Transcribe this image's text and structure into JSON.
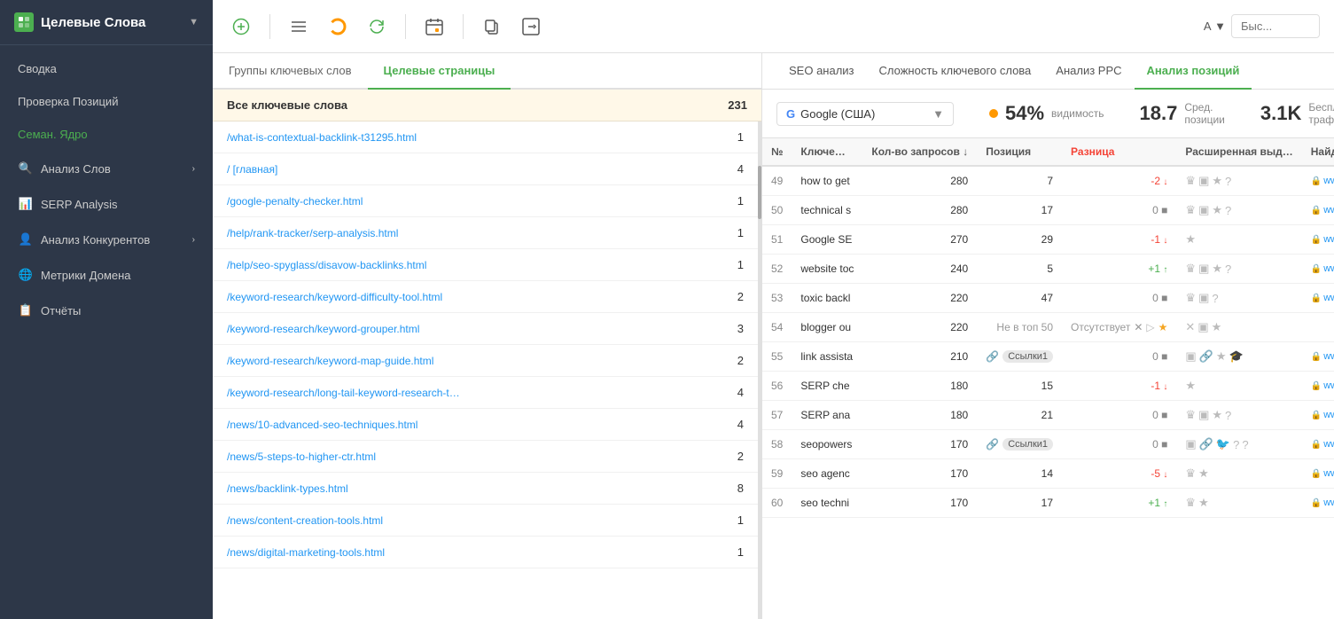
{
  "sidebar": {
    "title": "Целевые Слова",
    "items": [
      {
        "id": "svodka",
        "label": "Сводка",
        "active": false
      },
      {
        "id": "proverka",
        "label": "Проверка Позиций",
        "active": false
      },
      {
        "id": "seman",
        "label": "Семан. Ядро",
        "active": true
      },
      {
        "id": "analiz-slov",
        "label": "Анализ Слов",
        "active": false,
        "hasArrow": true
      },
      {
        "id": "serp",
        "label": "SERP Analysis",
        "active": false
      },
      {
        "id": "konkurentov",
        "label": "Анализ Конкурентов",
        "active": false,
        "hasArrow": true
      },
      {
        "id": "metriki",
        "label": "Метрики Домена",
        "active": false
      },
      {
        "id": "otchety",
        "label": "Отчёты",
        "active": false
      }
    ]
  },
  "toolbar": {
    "search_placeholder": "Быс...",
    "search_label": "А ▼"
  },
  "left_panel": {
    "tabs": [
      {
        "id": "groups",
        "label": "Группы ключевых слов"
      },
      {
        "id": "pages",
        "label": "Целевые страницы",
        "active": true
      }
    ],
    "pages_header": {
      "title": "Все ключевые слова",
      "count": "231"
    },
    "pages": [
      {
        "url": "/what-is-contextual-backlink-t31295.html",
        "count": "1"
      },
      {
        "url": "/   [главная]",
        "count": "4"
      },
      {
        "url": "/google-penalty-checker.html",
        "count": "1"
      },
      {
        "url": "/help/rank-tracker/serp-analysis.html",
        "count": "1"
      },
      {
        "url": "/help/seo-spyglass/disavow-backlinks.html",
        "count": "1"
      },
      {
        "url": "/keyword-research/keyword-difficulty-tool.html",
        "count": "2"
      },
      {
        "url": "/keyword-research/keyword-grouper.html",
        "count": "3"
      },
      {
        "url": "/keyword-research/keyword-map-guide.html",
        "count": "2"
      },
      {
        "url": "/keyword-research/long-tail-keyword-research-t…",
        "count": "4"
      },
      {
        "url": "/news/10-advanced-seo-techniques.html",
        "count": "4"
      },
      {
        "url": "/news/5-steps-to-higher-ctr.html",
        "count": "2"
      },
      {
        "url": "/news/backlink-types.html",
        "count": "8"
      },
      {
        "url": "/news/content-creation-tools.html",
        "count": "1"
      },
      {
        "url": "/news/digital-marketing-tools.html",
        "count": "1"
      }
    ]
  },
  "right_panel": {
    "analysis_tabs": [
      {
        "id": "seo",
        "label": "SEO анализ"
      },
      {
        "id": "difficulty",
        "label": "Сложность ключевого слова"
      },
      {
        "id": "ppc",
        "label": "Анализ PPC"
      },
      {
        "id": "positions",
        "label": "Анализ позиций",
        "active": true
      }
    ],
    "stats": {
      "engine": "Google (США)",
      "visibility_pct": "54%",
      "visibility_label": "видимость",
      "avg_pos": "18.7",
      "avg_pos_label": "Сред. позиции",
      "traffic": "3.1K",
      "traffic_label": "Бесплатный трафик"
    },
    "table": {
      "columns": [
        "№",
        "Ключе…",
        "Кол-во запросов ↓",
        "Позиция",
        "Разница",
        "Расширенная выд…",
        "Найденный URL"
      ],
      "rows": [
        {
          "num": "49",
          "keyword": "how to get",
          "requests": "280",
          "position": "7",
          "diff": "-2",
          "diff_dir": "down",
          "extended": [
            "crown",
            "image",
            "star",
            "help"
          ],
          "url": "www.link-assist…",
          "has_tag": false
        },
        {
          "num": "50",
          "keyword": "technical s",
          "requests": "280",
          "position": "17",
          "diff": "0",
          "diff_dir": "neutral",
          "extended": [
            "crown",
            "image",
            "star",
            "help"
          ],
          "url": "www.link-assist…",
          "has_tag": false
        },
        {
          "num": "51",
          "keyword": "Google SE",
          "requests": "270",
          "position": "29",
          "diff": "-1",
          "diff_dir": "down",
          "extended": [
            "star"
          ],
          "url": "www.link-assist…",
          "has_tag": false
        },
        {
          "num": "52",
          "keyword": "website toc",
          "requests": "240",
          "position": "5",
          "diff": "+1",
          "diff_dir": "up",
          "extended": [
            "crown",
            "image",
            "star",
            "help"
          ],
          "url": "www.link-assist…",
          "has_tag": false
        },
        {
          "num": "53",
          "keyword": "toxic backl",
          "requests": "220",
          "position": "47",
          "diff": "0",
          "diff_dir": "neutral",
          "extended": [
            "crown",
            "image",
            "help"
          ],
          "url": "www.link-assist…",
          "has_tag": false
        },
        {
          "num": "54",
          "keyword": "blogger ou",
          "requests": "220",
          "position": "Не в топ 50",
          "diff": "absent",
          "diff_dir": "absent",
          "extended": [
            "x",
            "image",
            "star"
          ],
          "url": "",
          "has_tag": false
        },
        {
          "num": "55",
          "keyword": "link assista",
          "requests": "210",
          "position": "Ссылки1",
          "diff": "0",
          "diff_dir": "neutral",
          "extended": [
            "image",
            "link",
            "star",
            "diploma"
          ],
          "url": "www.link-assist…",
          "has_tag": true,
          "tag_text": "Ссылки1"
        },
        {
          "num": "56",
          "keyword": "SERP che",
          "requests": "180",
          "position": "15",
          "diff": "-1",
          "diff_dir": "down",
          "extended": [
            "star"
          ],
          "url": "www.link-assist…",
          "has_tag": false
        },
        {
          "num": "57",
          "keyword": "SERP ana",
          "requests": "180",
          "position": "21",
          "diff": "0",
          "diff_dir": "neutral",
          "extended": [
            "crown",
            "image",
            "star",
            "help"
          ],
          "url": "www.link-assist…",
          "has_tag": false
        },
        {
          "num": "58",
          "keyword": "seopowers",
          "requests": "170",
          "position": "Ссылки1",
          "diff": "0",
          "diff_dir": "neutral",
          "extended": [
            "image",
            "link",
            "twitter",
            "help",
            "?"
          ],
          "url": "www.link-assist…",
          "has_tag": true,
          "tag_text": "Ссылки1"
        },
        {
          "num": "59",
          "keyword": "seo agenc",
          "requests": "170",
          "position": "14",
          "diff": "-5",
          "diff_dir": "down",
          "extended": [
            "crown",
            "star"
          ],
          "url": "www.link-assist…",
          "has_tag": false
        },
        {
          "num": "60",
          "keyword": "seo techni",
          "requests": "170",
          "position": "17",
          "diff": "+1",
          "diff_dir": "up",
          "extended": [
            "crown",
            "star"
          ],
          "url": "www.link-assist…",
          "has_tag": false
        }
      ]
    }
  }
}
